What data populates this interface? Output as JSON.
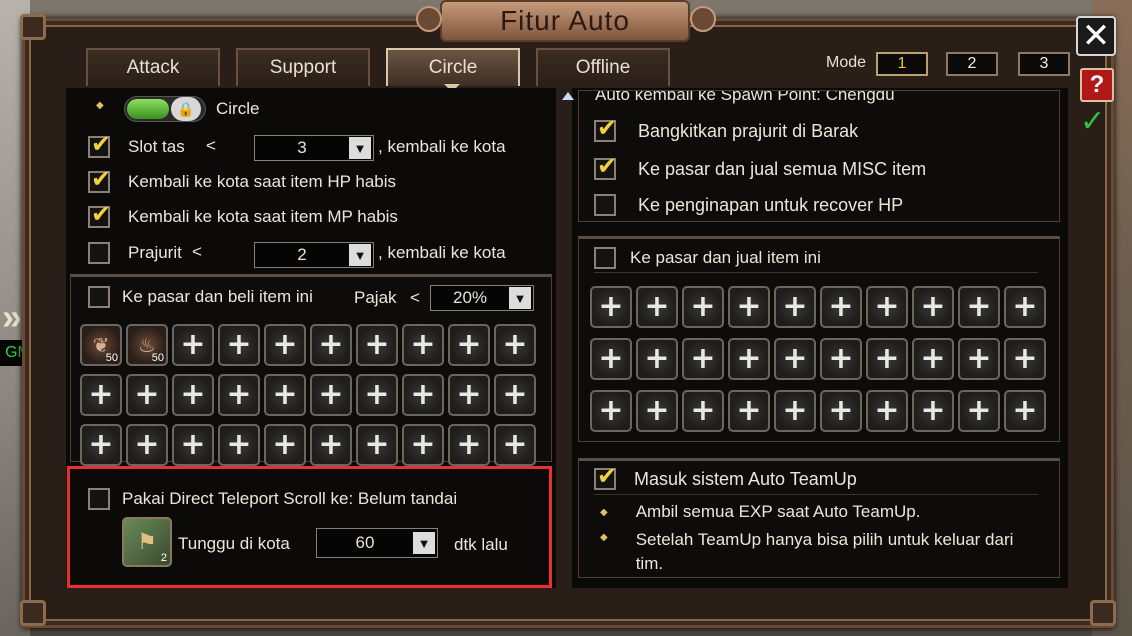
{
  "window": {
    "title": "Fitur Auto",
    "close_label": "✕",
    "help_label": "?"
  },
  "side": {
    "gm_label": "GM",
    "arrow_label": "»"
  },
  "tabs": [
    {
      "label": "Attack",
      "active": false
    },
    {
      "label": "Support",
      "active": false
    },
    {
      "label": "Circle",
      "active": true
    },
    {
      "label": "Offline",
      "active": false
    }
  ],
  "mode": {
    "label": "Mode",
    "options": [
      "1",
      "2",
      "3"
    ],
    "selected": "1"
  },
  "left": {
    "circle": {
      "label": "Circle",
      "enabled": true
    },
    "slot_tas": {
      "label": "Slot tas",
      "op": "<",
      "value": "3",
      "suffix": ", kembali ke kota",
      "checked": true
    },
    "hp": {
      "label": "Kembali ke kota saat item HP habis",
      "checked": true
    },
    "mp": {
      "label": "Kembali ke kota saat item MP habis",
      "checked": true
    },
    "prajurit": {
      "label": "Prajurit",
      "op": "<",
      "value": "2",
      "suffix": ", kembali ke kota",
      "checked": false
    },
    "buy": {
      "label": "Ke pasar dan beli item ini",
      "tax_label": "Pajak",
      "tax_op": "<",
      "tax_value": "20%",
      "checked": false,
      "items": [
        {
          "kind": "item",
          "icon": "hp-potion-icon",
          "count": "50"
        },
        {
          "kind": "item",
          "icon": "mp-potion-icon",
          "count": "50"
        }
      ]
    },
    "teleport": {
      "label": "Pakai Direct Teleport Scroll ke: Belum tandai",
      "checked": false,
      "wait_label": "Tunggu di kota",
      "wait_value": "60",
      "wait_suffix": "dtk lalu",
      "scroll_count": "2"
    }
  },
  "right": {
    "spawn_text": "Auto kembali ke Spawn Point: Chengdu",
    "options": [
      {
        "label": "Bangkitkan prajurit di Barak",
        "checked": true
      },
      {
        "label": "Ke pasar dan jual semua MISC item",
        "checked": true
      },
      {
        "label": "Ke penginapan untuk recover HP",
        "checked": false
      }
    ],
    "sell": {
      "label": "Ke pasar dan jual item ini",
      "checked": false
    },
    "teamup": {
      "label": "Masuk sistem Auto TeamUp",
      "checked": true,
      "notes": [
        "Ambil semua EXP saat Auto TeamUp.",
        "Setelah TeamUp hanya bisa pilih untuk keluar dari tim."
      ]
    }
  }
}
